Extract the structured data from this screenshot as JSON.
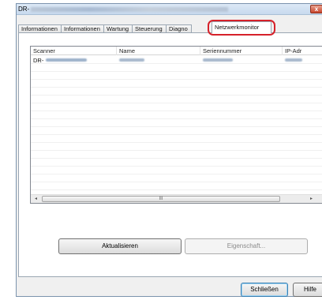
{
  "window": {
    "title_prefix": "DR-",
    "close_glyph": "x"
  },
  "tabs": [
    {
      "label": "Informationen"
    },
    {
      "label": "Informationen"
    },
    {
      "label": "Wartung"
    },
    {
      "label": "Steuerung"
    },
    {
      "label": "Diagno"
    },
    {
      "label": "Netzwerkmonitor",
      "active": true
    }
  ],
  "table": {
    "columns": [
      "Scanner",
      "Name",
      "Seriennummer",
      "IP-Adr"
    ],
    "rows": [
      {
        "scanner": "DR-"
      }
    ]
  },
  "scrollbar": {
    "left_arrow": "◂",
    "right_arrow": "▸",
    "grip": "III"
  },
  "buttons": {
    "refresh": "Aktualisieren",
    "properties": "Eigenschaft...",
    "close": "Schließen",
    "help": "Hilfe"
  },
  "colors": {
    "highlight": "#d6212a"
  }
}
